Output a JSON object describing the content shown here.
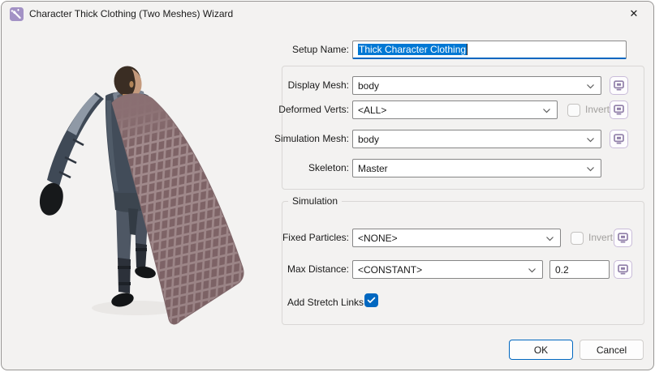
{
  "window": {
    "title": "Character Thick Clothing (Two Meshes) Wizard",
    "icon": "magic-wand-icon",
    "close_glyph": "✕"
  },
  "colors": {
    "accent": "#0067c0",
    "text_selection": "#0078d4",
    "pick_button_icon": "#9180a9",
    "title_icon_bg": "#a392c5",
    "cape": "#8a6f72"
  },
  "form": {
    "setup_name": {
      "label": "Setup Name:",
      "value": "Thick Character Clothing"
    },
    "display_mesh": {
      "label": "Display Mesh:",
      "value": "body"
    },
    "deformed_verts": {
      "label": "Deformed Verts:",
      "value": "<ALL>",
      "invert_label": "Invert",
      "invert_checked": false
    },
    "simulation_mesh": {
      "label": "Simulation Mesh:",
      "value": "body"
    },
    "skeleton": {
      "label": "Skeleton:",
      "value": "Master"
    },
    "simulation": {
      "title": "Simulation",
      "fixed_particles": {
        "label": "Fixed Particles:",
        "value": "<NONE>",
        "invert_label": "Invert",
        "invert_checked": false
      },
      "max_distance": {
        "label": "Max Distance:",
        "value": "<CONSTANT>",
        "amount": "0.2"
      },
      "add_stretch_links": {
        "label": "Add Stretch Links",
        "checked": true
      }
    },
    "actions": {
      "ok": "OK",
      "cancel": "Cancel"
    }
  }
}
